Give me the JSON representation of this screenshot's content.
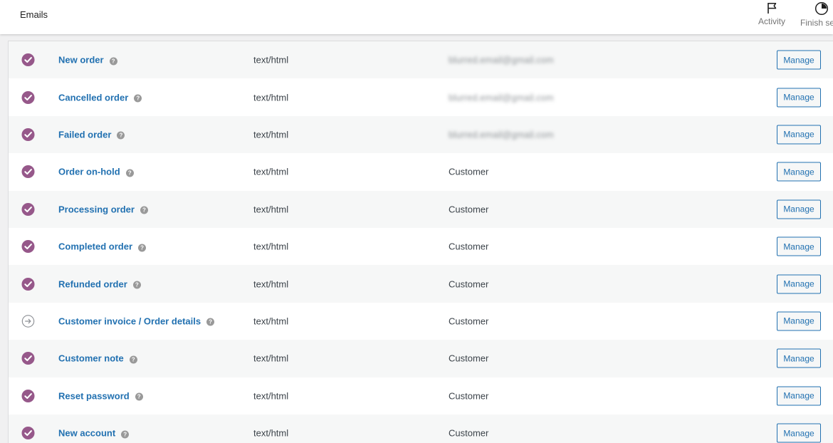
{
  "header": {
    "title": "Emails",
    "actions": [
      {
        "label": "Activity",
        "icon": "flag-icon"
      },
      {
        "label": "Finish setup",
        "icon": "progress-pie-icon"
      }
    ]
  },
  "colors": {
    "enabled_check": "#96588a",
    "link": "#2271b1",
    "manual_arrow": "#8c8f94"
  },
  "table": {
    "rows": [
      {
        "title": "New order",
        "content_type": "text/html",
        "recipient": "blurred.email@gmail.com",
        "recipient_blurred": true,
        "status": "enabled",
        "button": "Manage"
      },
      {
        "title": "Cancelled order",
        "content_type": "text/html",
        "recipient": "blurred.email@gmail.com",
        "recipient_blurred": true,
        "status": "enabled",
        "button": "Manage"
      },
      {
        "title": "Failed order",
        "content_type": "text/html",
        "recipient": "blurred.email@gmail.com",
        "recipient_blurred": true,
        "status": "enabled",
        "button": "Manage"
      },
      {
        "title": "Order on-hold",
        "content_type": "text/html",
        "recipient": "Customer",
        "recipient_blurred": false,
        "status": "enabled",
        "button": "Manage"
      },
      {
        "title": "Processing order",
        "content_type": "text/html",
        "recipient": "Customer",
        "recipient_blurred": false,
        "status": "enabled",
        "button": "Manage"
      },
      {
        "title": "Completed order",
        "content_type": "text/html",
        "recipient": "Customer",
        "recipient_blurred": false,
        "status": "enabled",
        "button": "Manage"
      },
      {
        "title": "Refunded order",
        "content_type": "text/html",
        "recipient": "Customer",
        "recipient_blurred": false,
        "status": "enabled",
        "button": "Manage"
      },
      {
        "title": "Customer invoice / Order details",
        "content_type": "text/html",
        "recipient": "Customer",
        "recipient_blurred": false,
        "status": "manual",
        "button": "Manage"
      },
      {
        "title": "Customer note",
        "content_type": "text/html",
        "recipient": "Customer",
        "recipient_blurred": false,
        "status": "enabled",
        "button": "Manage"
      },
      {
        "title": "Reset password",
        "content_type": "text/html",
        "recipient": "Customer",
        "recipient_blurred": false,
        "status": "enabled",
        "button": "Manage"
      },
      {
        "title": "New account",
        "content_type": "text/html",
        "recipient": "Customer",
        "recipient_blurred": false,
        "status": "enabled",
        "button": "Manage"
      }
    ]
  }
}
